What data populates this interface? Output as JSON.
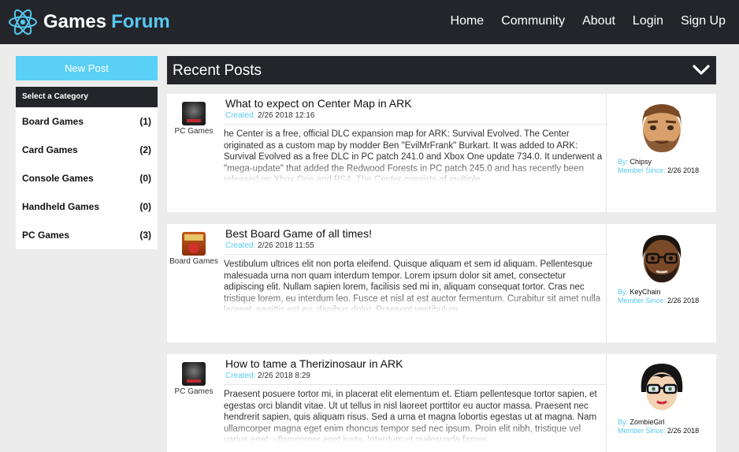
{
  "header": {
    "brand_main": "Games",
    "brand_accent": "Forum",
    "nav": [
      "Home",
      "Community",
      "About",
      "Login",
      "Sign Up"
    ]
  },
  "sidebar": {
    "new_post": "New Post",
    "category_heading": "Select a Category",
    "categories": [
      {
        "name": "Board Games",
        "count": "(1)"
      },
      {
        "name": "Card Games",
        "count": "(2)"
      },
      {
        "name": "Console Games",
        "count": "(0)"
      },
      {
        "name": "Handheld Games",
        "count": "(0)"
      },
      {
        "name": "PC Games",
        "count": "(3)"
      }
    ]
  },
  "recent": {
    "title": "Recent Posts",
    "labels": {
      "created": "Created:",
      "by": "By:",
      "member_since": "Member Since:"
    },
    "posts": [
      {
        "category": "PC Games",
        "title": "What to expect on Center Map in ARK",
        "created": "2/26 2018 12:16",
        "body": "he Center is a free, official DLC expansion map for ARK: Survival Evolved. The Center originated as a custom map by modder Ben \"EvilMrFrank\" Burkart. It was added to ARK: Survival Evolved as a free DLC in PC patch 241.0 and Xbox One update 734.0. It underwent a \"mega-update\" that added the Redwood Forests in PC patch 245.0 and has recently been released on Xbox One and PS4. The Center consists of multiple",
        "author": "Chipsy",
        "member_since": "2/26 2018"
      },
      {
        "category": "Board Games",
        "title": "Best Board Game of all times!",
        "created": "2/26 2018 11:55",
        "body": "Vestibulum ultrices elit non porta eleifend. Quisque aliquam et sem id aliquam. Pellentesque malesuada urna non quam interdum tempor. Lorem ipsum dolor sit amet, consectetur adipiscing elit. Nullam sapien lorem, facilisis sed mi in, aliquam consequat tortor. Cras nec tristique lorem, eu interdum leo. Fusce et nisl at est auctor fermentum. Curabitur sit amet nulla laoreet, sagittis est eu, dapibus dolor. Praesent vestibulum",
        "author": "KeyChain",
        "member_since": "2/26 2018"
      },
      {
        "category": "PC Games",
        "title": "How to tame a Therizinosaur in ARK",
        "created": "2/26 2018 8:29",
        "body": "Praesent posuere tortor mi, in placerat elit elementum et. Etiam pellentesque tortor sapien, et egestas orci blandit vitae. Ut ut tellus in nisl laoreet porttitor eu auctor massa. Praesent nec hendrerit sapien, quis aliquam risus. Sed a urna et magna lobortis egestas ut at magna. Nam ullamcorper magna eget enim rhoncus tempor sed nec ipsum. Proin elit nibh, tristique vel varius eget, ullamcorper eget justo. Interdum et malesuada fames",
        "author": "ZombieGirl",
        "member_since": "2/26 2018"
      }
    ]
  },
  "colors": {
    "accent": "#56c8f0",
    "button": "#5bd0f6",
    "dark": "#23252b",
    "background": "#ececec"
  },
  "icons": [
    "atom-logo-icon",
    "chevron-down-icon"
  ]
}
